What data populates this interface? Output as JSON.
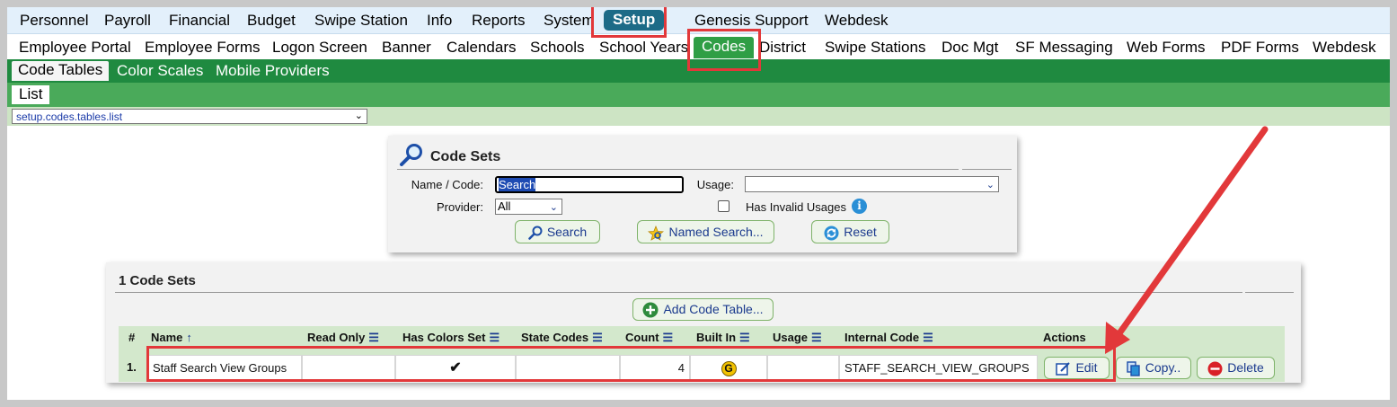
{
  "top_nav": {
    "items": [
      "Personnel",
      "Payroll",
      "Financial",
      "Budget",
      "Swipe Station",
      "Info",
      "Reports",
      "System",
      "Setup",
      "Genesis Support",
      "Webdesk"
    ],
    "active": "Setup"
  },
  "sub_nav": {
    "items": [
      "Employee Portal",
      "Employee Forms",
      "Logon Screen",
      "Banner",
      "Calendars",
      "Schools",
      "School Years",
      "Codes",
      "District",
      "Swipe Stations",
      "Doc Mgt",
      "SF Messaging",
      "Web Forms",
      "PDF Forms",
      "Webdesk"
    ],
    "active": "Codes"
  },
  "tab_bar": {
    "items": [
      "Code Tables",
      "Color Scales",
      "Mobile Providers"
    ],
    "active": "Code Tables"
  },
  "list_tab": "List",
  "page_select": "setup.codes.tables.list",
  "search_panel": {
    "title": "Code Sets",
    "name_code_label": "Name / Code:",
    "name_code_value": "Search",
    "usage_label": "Usage:",
    "usage_value": "",
    "provider_label": "Provider:",
    "provider_value": "All",
    "invalid_usages_label": "Has Invalid Usages",
    "search_button": "Search",
    "named_search_button": "Named Search...",
    "reset_button": "Reset"
  },
  "results": {
    "title": "1 Code Sets",
    "add_button": "Add Code Table...",
    "columns": [
      "#",
      "Name",
      "Read Only",
      "Has Colors Set",
      "State Codes",
      "Count",
      "Built In",
      "Usage",
      "Internal Code",
      "Actions"
    ],
    "rows": [
      {
        "num": "1.",
        "name": "Staff Search View Groups",
        "read_only": "",
        "has_colors_set": "✔",
        "state_codes": "",
        "count": "4",
        "built_in": "G",
        "usage": "",
        "internal_code": "STAFF_SEARCH_VIEW_GROUPS",
        "actions": {
          "edit": "Edit",
          "copy": "Copy..",
          "delete": "Delete"
        }
      }
    ]
  },
  "colors": {
    "active_top": "#1d6b87",
    "active_sub": "#2f9e45",
    "green_bar": "#1f8a40",
    "highlight": "#e2383a"
  }
}
